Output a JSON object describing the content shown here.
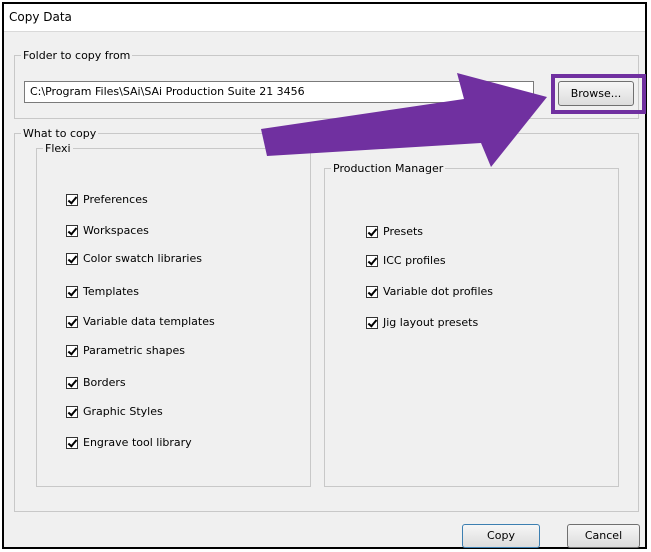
{
  "window": {
    "title": "Copy Data"
  },
  "source_group": {
    "legend": "Folder to copy from",
    "path_value": "C:\\Program Files\\SAi\\SAi Production Suite 21 3456",
    "browse_label": "Browse..."
  },
  "what_group": {
    "legend": "What to copy"
  },
  "flexi": {
    "legend": "Flexi",
    "items": [
      {
        "label": "Preferences",
        "checked": true
      },
      {
        "label": "Workspaces",
        "checked": true
      },
      {
        "label": "Color swatch libraries",
        "checked": true
      },
      {
        "label": "Templates",
        "checked": true
      },
      {
        "label": "Variable data templates",
        "checked": true
      },
      {
        "label": "Parametric shapes",
        "checked": true
      },
      {
        "label": "Borders",
        "checked": true
      },
      {
        "label": "Graphic Styles",
        "checked": true
      },
      {
        "label": "Engrave tool library",
        "checked": true
      }
    ]
  },
  "production_manager": {
    "legend": "Production Manager",
    "items": [
      {
        "label": "Presets",
        "checked": true
      },
      {
        "label": "ICC profiles",
        "checked": true
      },
      {
        "label": "Variable dot profiles",
        "checked": true
      },
      {
        "label": "Jig layout presets",
        "checked": true
      }
    ]
  },
  "footer": {
    "copy_label": "Copy",
    "cancel_label": "Cancel"
  },
  "colors": {
    "annotation_arrow": "#7030a0"
  }
}
